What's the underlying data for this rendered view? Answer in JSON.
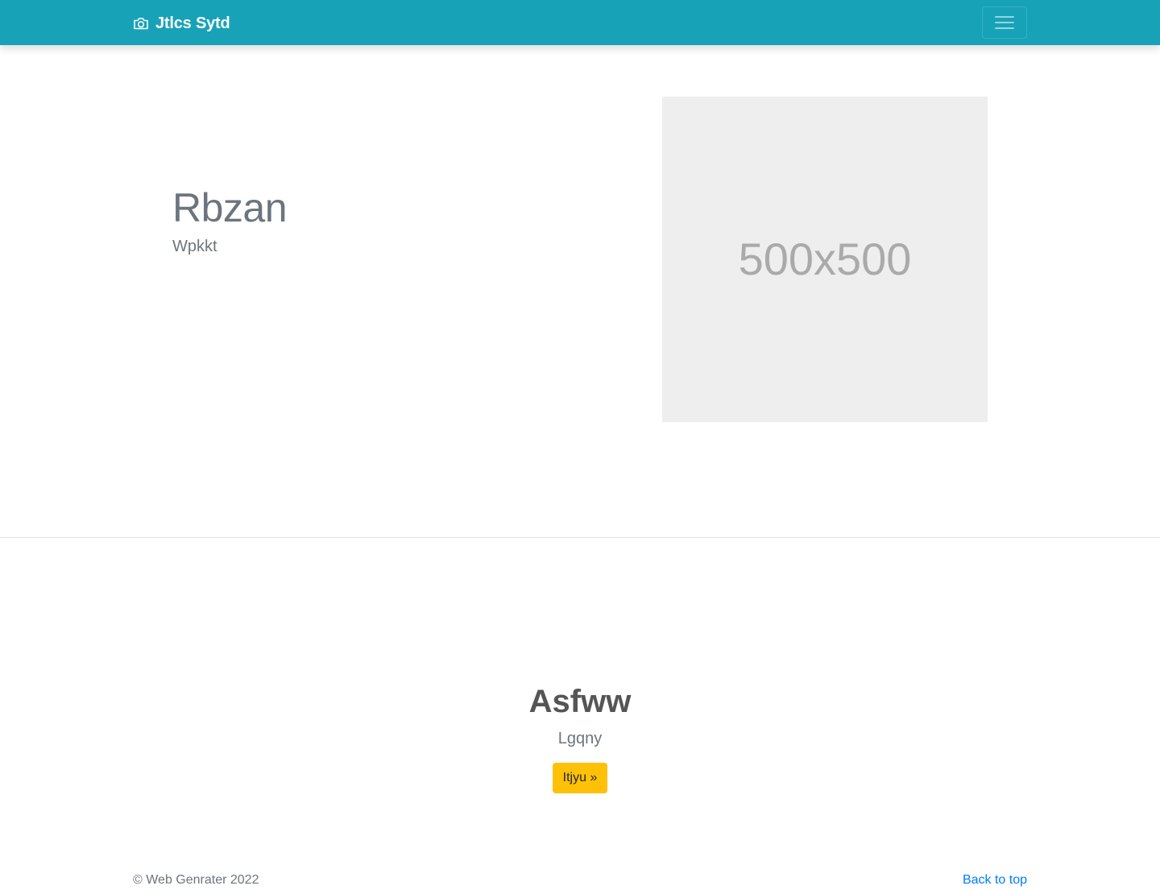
{
  "navbar": {
    "brand_icon": "camera-icon",
    "brand": "Jtlcs Sytd",
    "toggler_icon": "hamburger-menu-icon",
    "background": "#17a2b8"
  },
  "hero": {
    "title": "Rbzan",
    "subtitle": "Wpkkt",
    "image_placeholder": "500x500"
  },
  "cta": {
    "title": "Asfww",
    "subtitle": "Lgqny",
    "button_label": "Itjyu »",
    "button_color": "#ffc107"
  },
  "footer": {
    "copyright": "© Web Genrater 2022",
    "back_to_top": "Back to top",
    "link_color": "#007bff"
  }
}
